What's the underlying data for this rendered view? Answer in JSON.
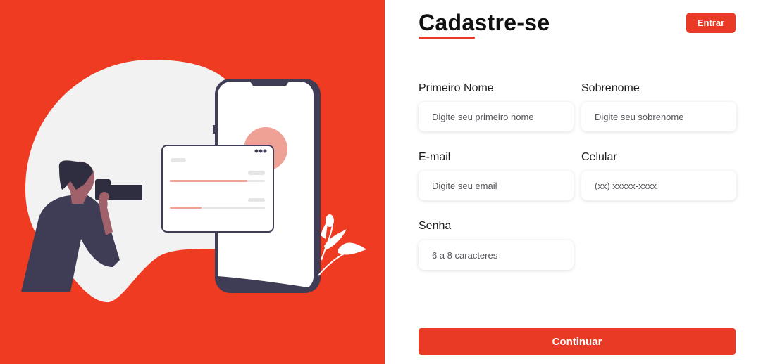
{
  "colors": {
    "brand": "#f03b23",
    "accent": "#e83a24",
    "background": "#ffffff"
  },
  "illustration": {
    "name": "photographer-phone-illustration"
  },
  "header": {
    "title": "Cadastre-se",
    "login_label": "Entrar"
  },
  "form": {
    "first_name": {
      "label": "Primeiro Nome",
      "placeholder": "Digite seu primeiro nome"
    },
    "last_name": {
      "label": "Sobrenome",
      "placeholder": "Digite seu sobrenome"
    },
    "email": {
      "label": "E-mail",
      "placeholder": "Digite seu email"
    },
    "phone": {
      "label": "Celular",
      "placeholder": "(xx) xxxxx-xxxx"
    },
    "password": {
      "label": "Senha",
      "placeholder": "6 a 8 caracteres"
    },
    "submit_label": "Continuar"
  }
}
